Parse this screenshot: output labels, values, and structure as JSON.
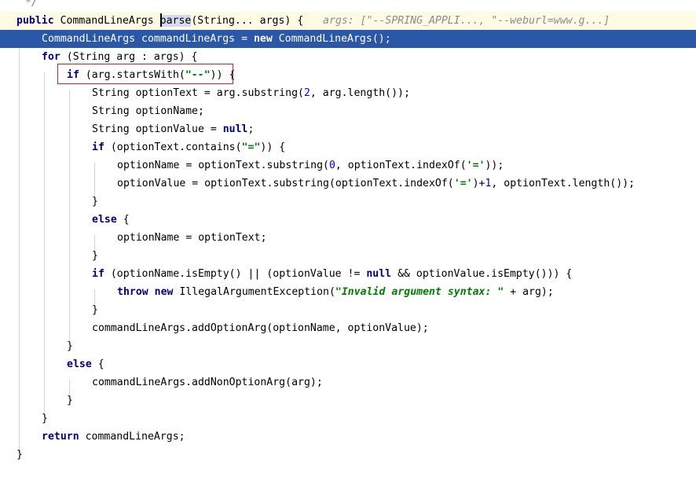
{
  "editor": {
    "lines": {
      "l0": {
        "comment": "*/"
      },
      "l1": {
        "public_kw": "public",
        "ret_type": "CommandLineArgs ",
        "method_name": "parse",
        "params": "(String... args) {",
        "hint": "args: [\"--SPRING_APPLI..., \"--weburl=www.g...]"
      },
      "l2": {
        "decl": "CommandLineArgs commandLineArgs = ",
        "new_kw": "new",
        "rest": " CommandLineArgs();"
      },
      "l3": {
        "for_kw": "for",
        "rest": " (String arg : args) {"
      },
      "l4": {
        "if_kw": "if",
        "pre": " (arg.startsWith(",
        "str": "\"--\"",
        "post": ")) {"
      },
      "l5": {
        "pre": "String optionText = arg.substring(",
        "num": "2",
        "post": ", arg.length());"
      },
      "l6": {
        "text": "String optionName;"
      },
      "l7": {
        "pre": "String optionValue = ",
        "null_kw": "null",
        "post": ";"
      },
      "l8": {
        "if_kw": "if",
        "pre": " (optionText.contains(",
        "str": "\"=\"",
        "post": ")) {"
      },
      "l9": {
        "pre": "optionName = optionText.substring(",
        "num": "0",
        "mid": ", optionText.indexOf(",
        "str": "'='",
        "post": "));"
      },
      "l10": {
        "pre": "optionValue = optionText.substring(optionText.indexOf(",
        "str": "'='",
        "mid": ")+",
        "num": "1",
        "post": ", optionText.length());"
      },
      "l11": {
        "text": "}"
      },
      "l12": {
        "else_kw": "else",
        "rest": " {"
      },
      "l13": {
        "text": "optionName = optionText;"
      },
      "l14": {
        "text": "}"
      },
      "l15": {
        "if_kw": "if",
        "pre": " (optionName.isEmpty() || (optionValue != ",
        "null_kw": "null",
        "post": " && optionValue.isEmpty())) {"
      },
      "l16": {
        "throw_kw": "throw",
        "new_kw": "new",
        "pre": " IllegalArgumentException(",
        "str": "\"Invalid argument syntax: \"",
        "post": " + arg);"
      },
      "l17": {
        "text": "}"
      },
      "l18": {
        "text": "commandLineArgs.addOptionArg(optionName, optionValue);"
      },
      "l19": {
        "text": "}"
      },
      "l20": {
        "else_kw": "else",
        "rest": " {"
      },
      "l21": {
        "text": "commandLineArgs.addNonOptionArg(arg);"
      },
      "l22": {
        "text": "}"
      },
      "l23": {
        "text": "}"
      },
      "l24": {
        "return_kw": "return",
        "rest": " commandLineArgs;"
      },
      "l25": {
        "text": "}"
      }
    },
    "colors": {
      "keyword": "#000080",
      "string": "#008000",
      "number": "#0000ff",
      "selection": "#2a57a8",
      "current_line": "#fffae3",
      "annotation_box": "#e02020"
    }
  }
}
